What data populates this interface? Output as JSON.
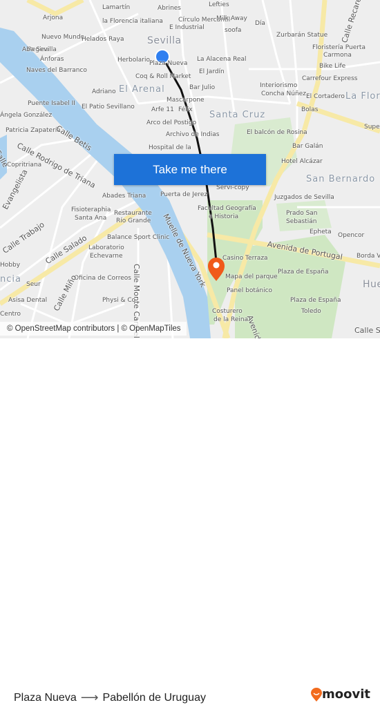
{
  "map": {
    "accent_color": "#1d72d8",
    "route_color": "#111111",
    "destination_marker_color": "#f05a1a",
    "labels": [
      "Lamartín",
      "Abrines",
      "Lefties",
      "la Florencia italiana",
      "Círculo Mercantil",
      "E Industrial",
      "Milk Away",
      "Día",
      "Arjona",
      "Nuevo Mundo",
      "Regina",
      "Helados Raya",
      "Sevilla",
      "soofa",
      "Zurbarán Statue",
      "Floristería Puerta",
      "Carmona",
      "Aba Sevilla",
      "Ánforas",
      "Naves del Barranco",
      "Herbolario",
      "Plaza Nueva",
      "La Alacena Real",
      "Bike Life",
      "El Jardín",
      "Coq & Roll Market",
      "Carrefour Express",
      "Bar Julio",
      "Interiorismo",
      "Concha Núñez",
      "El Arenal",
      "Adriano",
      "El Cortadero",
      "La Flori",
      "Puente Isabel II",
      "El Patio Sevillano",
      "Mascarpone",
      "Arfe 11",
      "Félix",
      "Santa Cruz",
      "Bolas",
      "Ángela González",
      "Arco del Postigo",
      "Patricia Zapatería",
      "Calle Betis",
      "Archivo de Indias",
      "El balcón de Rosina",
      "Calle Rodrigo de Triana",
      "Hospital de la",
      "Bar Galán",
      "Copritriana",
      "Hotel Alcázar",
      "Servi-copy",
      "San Bernardo",
      "Evangelista",
      "Abades Triana",
      "Puerta de Jerez",
      "Juzgados de Sevilla",
      "Fisioteraphia",
      "Santa Ana",
      "Restaurante",
      "Río Grande",
      "Facultad Geografía",
      "e Historia",
      "Prado San",
      "Sebastián",
      "Muelle de Nueva York",
      "Calle Trabajo",
      "Epheta",
      "Opencor",
      "Balance Sport Clinic",
      "Avenida de Portugal",
      "Calle Salado",
      "Laboratorio",
      "Echevarne",
      "Casino Terraza",
      "Borda V",
      "Hobby",
      "Calle Monte Carmelo",
      "Plaza de España",
      "Mapa del parque",
      "Oficina de Correos",
      "Hue",
      "Calle Miño",
      "Seur",
      "Panel botánico",
      "Asisa Dental",
      "Physi & Co",
      "Plaza de España",
      "Toledo",
      "Costurero",
      "de la Reina",
      "Avenida",
      "Centro",
      "Calle Recaredo",
      "Calle S",
      "Calle",
      "Supe",
      "ncia"
    ],
    "cta_label": "Take me there",
    "attribution": "© OpenStreetMap contributors | © OpenMapTiles"
  },
  "footer": {
    "origin": "Plaza Nueva",
    "arrow": "⟶",
    "destination": "Pabellón de Uruguay",
    "brand": "moovit",
    "brand_color": "#f26b1d"
  }
}
